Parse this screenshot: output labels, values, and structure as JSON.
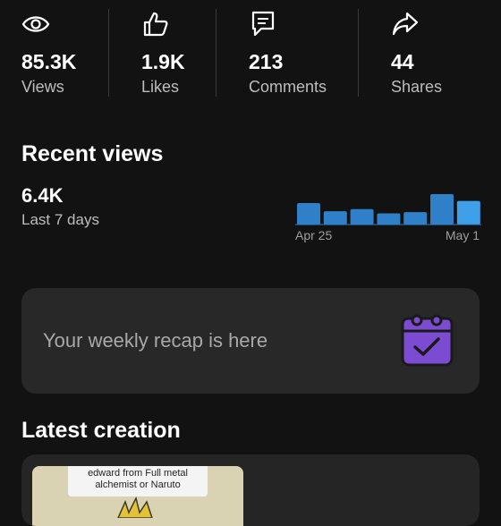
{
  "stats": [
    {
      "icon": "eye-icon",
      "value": "85.3K",
      "label": "Views"
    },
    {
      "icon": "thumbs-up-icon",
      "value": "1.9K",
      "label": "Likes"
    },
    {
      "icon": "comment-icon",
      "value": "213",
      "label": "Comments"
    },
    {
      "icon": "share-icon",
      "value": "44",
      "label": "Shares"
    }
  ],
  "recent_views": {
    "title": "Recent views",
    "value": "6.4K",
    "period": "Last 7 days",
    "start_label": "Apr 25",
    "end_label": "May 1"
  },
  "chart_data": {
    "type": "bar",
    "categories": [
      "Apr 25",
      "",
      "",
      "",
      "",
      "",
      "May 1"
    ],
    "values": [
      1.0,
      0.62,
      0.72,
      0.52,
      0.58,
      1.42,
      1.1
    ],
    "colors": [
      "#2f80c8",
      "#2f80c8",
      "#2f80c8",
      "#2f80c8",
      "#2f80c8",
      "#2f80c8",
      "#3f9fe8"
    ],
    "ylim": [
      0,
      1.5
    ]
  },
  "recap": {
    "text": "Your weekly recap is here",
    "icon": "calendar-check-icon"
  },
  "latest_creation": {
    "title": "Latest creation",
    "caption_line1": "edward from Full metal",
    "caption_line2": "alchemist or Naruto"
  },
  "colors": {
    "background": "#121212",
    "card": "#282828",
    "bar": "#2f80c8",
    "bar_highlight": "#3f9fe8",
    "recap_icon": "#7b4bd1"
  }
}
